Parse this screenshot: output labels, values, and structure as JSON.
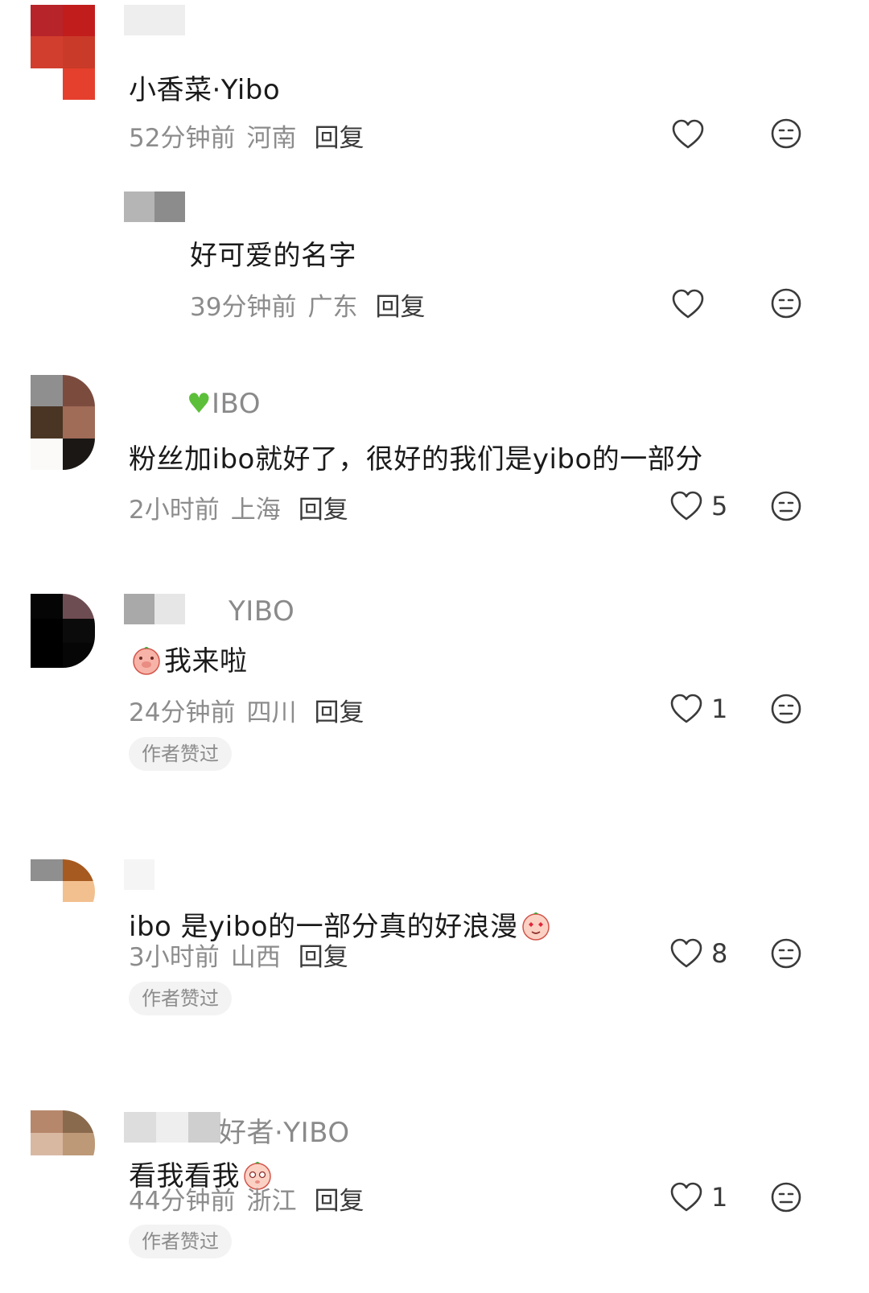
{
  "comments": [
    {
      "name_suffix": "",
      "text": "小香菜·Yibo",
      "time": "52分钟前",
      "location": "河南",
      "reply": "回复",
      "likes": "",
      "badge": ""
    },
    {
      "name_suffix": "",
      "text": "好可爱的名字",
      "time": "39分钟前",
      "location": "广东",
      "reply": "回复",
      "likes": "",
      "badge": ""
    },
    {
      "name_suffix": "IBO",
      "text": "粉丝加ibo就好了，很好的我们是yibo的一部分",
      "time": "2小时前",
      "location": "上海",
      "reply": "回复",
      "likes": "5",
      "badge": ""
    },
    {
      "name_suffix": "YIBO",
      "text": "我来啦",
      "time": "24分钟前",
      "location": "四川",
      "reply": "回复",
      "likes": "1",
      "badge": "作者赞过"
    },
    {
      "name_suffix": "",
      "text": "ibo 是yibo的一部分真的好浪漫",
      "time": "3小时前",
      "location": "山西",
      "reply": "回复",
      "likes": "8",
      "badge": "作者赞过"
    },
    {
      "name_suffix": "好者·YIBO",
      "text": "看我看我",
      "time": "44分钟前",
      "location": "浙江",
      "reply": "回复",
      "likes": "1",
      "badge": "作者赞过"
    }
  ],
  "icons": {
    "like": "heart-outline-icon",
    "dislike": "neutral-face-icon",
    "heart_emoji": "green-heart-emoji"
  },
  "colors": {
    "meta": "#8c8c8c",
    "text": "#1a1a1a",
    "badge_bg": "#f3f3f3",
    "green_heart": "#5cbf3a"
  }
}
